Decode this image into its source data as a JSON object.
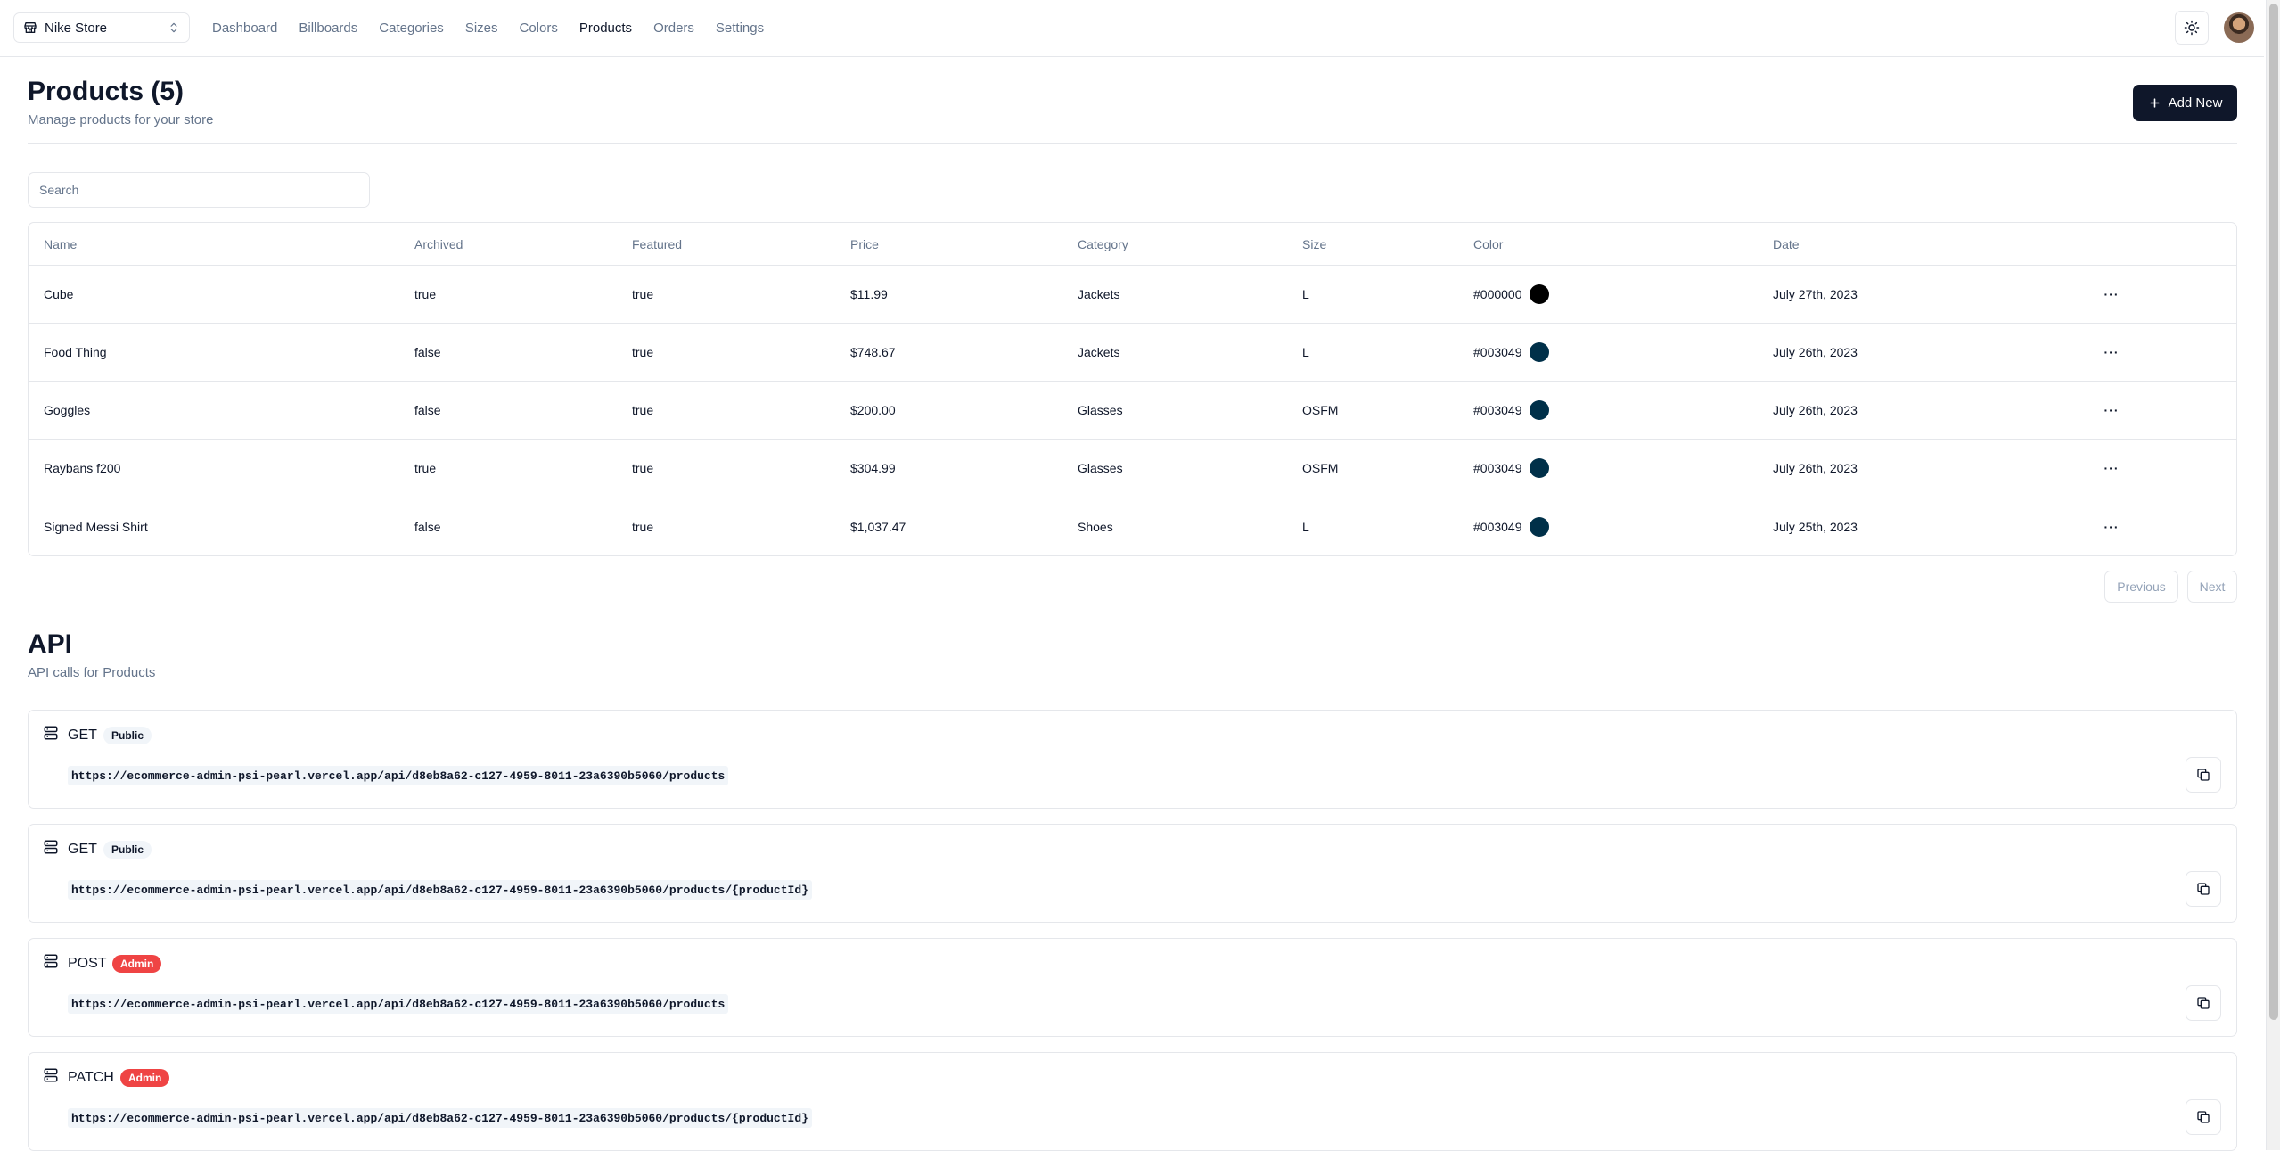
{
  "navbar": {
    "store_name": "Nike Store",
    "links": [
      "Dashboard",
      "Billboards",
      "Categories",
      "Sizes",
      "Colors",
      "Products",
      "Orders",
      "Settings"
    ],
    "active": "Products"
  },
  "heading": {
    "title": "Products (5)",
    "subtitle": "Manage products for your store",
    "add_label": "Add New"
  },
  "search": {
    "placeholder": "Search"
  },
  "table": {
    "columns": [
      "Name",
      "Archived",
      "Featured",
      "Price",
      "Category",
      "Size",
      "Color",
      "Date"
    ],
    "rows": [
      {
        "name": "Cube",
        "archived": "true",
        "featured": "true",
        "price": "$11.99",
        "category": "Jackets",
        "size": "L",
        "color": "#000000",
        "date": "July 27th, 2023"
      },
      {
        "name": "Food Thing",
        "archived": "false",
        "featured": "true",
        "price": "$748.67",
        "category": "Jackets",
        "size": "L",
        "color": "#003049",
        "date": "July 26th, 2023"
      },
      {
        "name": "Goggles",
        "archived": "false",
        "featured": "true",
        "price": "$200.00",
        "category": "Glasses",
        "size": "OSFM",
        "color": "#003049",
        "date": "July 26th, 2023"
      },
      {
        "name": "Raybans f200",
        "archived": "true",
        "featured": "true",
        "price": "$304.99",
        "category": "Glasses",
        "size": "OSFM",
        "color": "#003049",
        "date": "July 26th, 2023"
      },
      {
        "name": "Signed Messi Shirt",
        "archived": "false",
        "featured": "true",
        "price": "$1,037.47",
        "category": "Shoes",
        "size": "L",
        "color": "#003049",
        "date": "July 25th, 2023"
      }
    ]
  },
  "pagination": {
    "previous": "Previous",
    "next": "Next"
  },
  "api": {
    "title": "API",
    "subtitle": "API calls for Products",
    "endpoints": [
      {
        "method": "GET",
        "access": "Public",
        "url": "https://ecommerce-admin-psi-pearl.vercel.app/api/d8eb8a62-c127-4959-8011-23a6390b5060/products"
      },
      {
        "method": "GET",
        "access": "Public",
        "url": "https://ecommerce-admin-psi-pearl.vercel.app/api/d8eb8a62-c127-4959-8011-23a6390b5060/products/{productId}"
      },
      {
        "method": "POST",
        "access": "Admin",
        "url": "https://ecommerce-admin-psi-pearl.vercel.app/api/d8eb8a62-c127-4959-8011-23a6390b5060/products"
      },
      {
        "method": "PATCH",
        "access": "Admin",
        "url": "https://ecommerce-admin-psi-pearl.vercel.app/api/d8eb8a62-c127-4959-8011-23a6390b5060/products/{productId}"
      }
    ]
  },
  "colors": {
    "primary": "#0f172a",
    "muted": "#64748b",
    "border": "#e5e7eb",
    "admin_badge": "#ef4444"
  },
  "icons": [
    "store-icon",
    "chevrons-up-down-icon",
    "sun-icon",
    "plus-icon",
    "more-horizontal-icon",
    "server-icon",
    "copy-icon"
  ]
}
